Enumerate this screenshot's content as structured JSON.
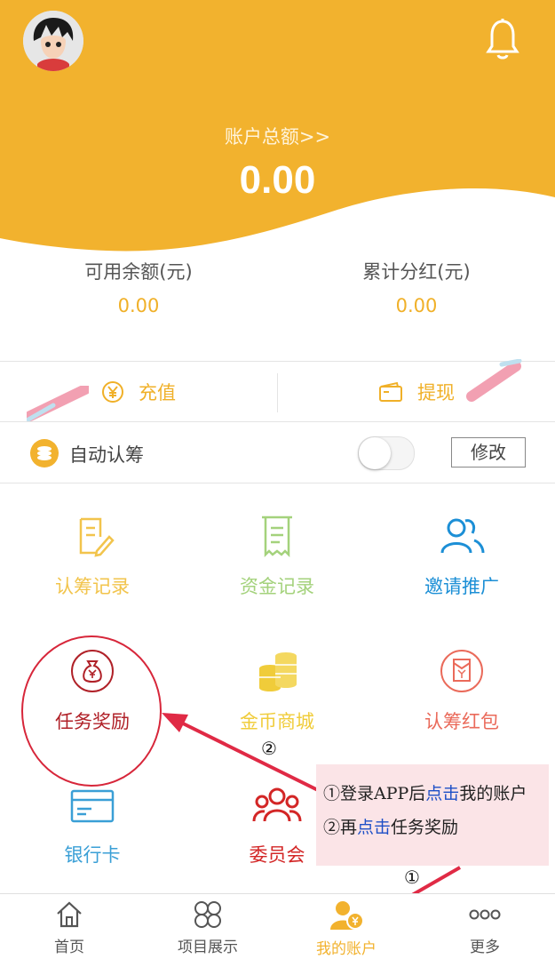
{
  "header": {
    "total_label": "账户总额>>",
    "total_value": "0.00"
  },
  "stats": [
    {
      "label": "可用余额(元)",
      "value": "0.00"
    },
    {
      "label": "累计分红(元)",
      "value": "0.00"
    }
  ],
  "actions": {
    "recharge": "充值",
    "withdraw": "提现"
  },
  "auto_subscribe": {
    "label": "自动认筹",
    "toggle_on": false,
    "modify": "修改"
  },
  "grid": [
    {
      "label": "认筹记录",
      "color": "#f2c44c"
    },
    {
      "label": "资金记录",
      "color": "#a4d27c"
    },
    {
      "label": "邀请推广",
      "color": "#1c8fd6"
    },
    {
      "label": "任务奖励",
      "color": "#b02128"
    },
    {
      "label": "金币商城",
      "color": "#f0cc3a"
    },
    {
      "label": "认筹红包",
      "color": "#ea6a5a"
    },
    {
      "label": "银行卡",
      "color": "#3a9fd6"
    },
    {
      "label": "委员会",
      "color": "#d32626"
    }
  ],
  "annotation": {
    "line1_a": "①登录APP后",
    "line1_b": "点击",
    "line1_c": "我的账户",
    "line2_a": "②再",
    "line2_b": "点击",
    "line2_c": "任务奖励",
    "marker1": "①",
    "marker2": "②"
  },
  "nav": [
    {
      "label": "首页"
    },
    {
      "label": "项目展示"
    },
    {
      "label": "我的账户",
      "active": true
    },
    {
      "label": "更多"
    }
  ],
  "colors": {
    "brand": "#f2b22e",
    "accent_text": "#f0b028",
    "annotation_red": "#e02a45"
  }
}
